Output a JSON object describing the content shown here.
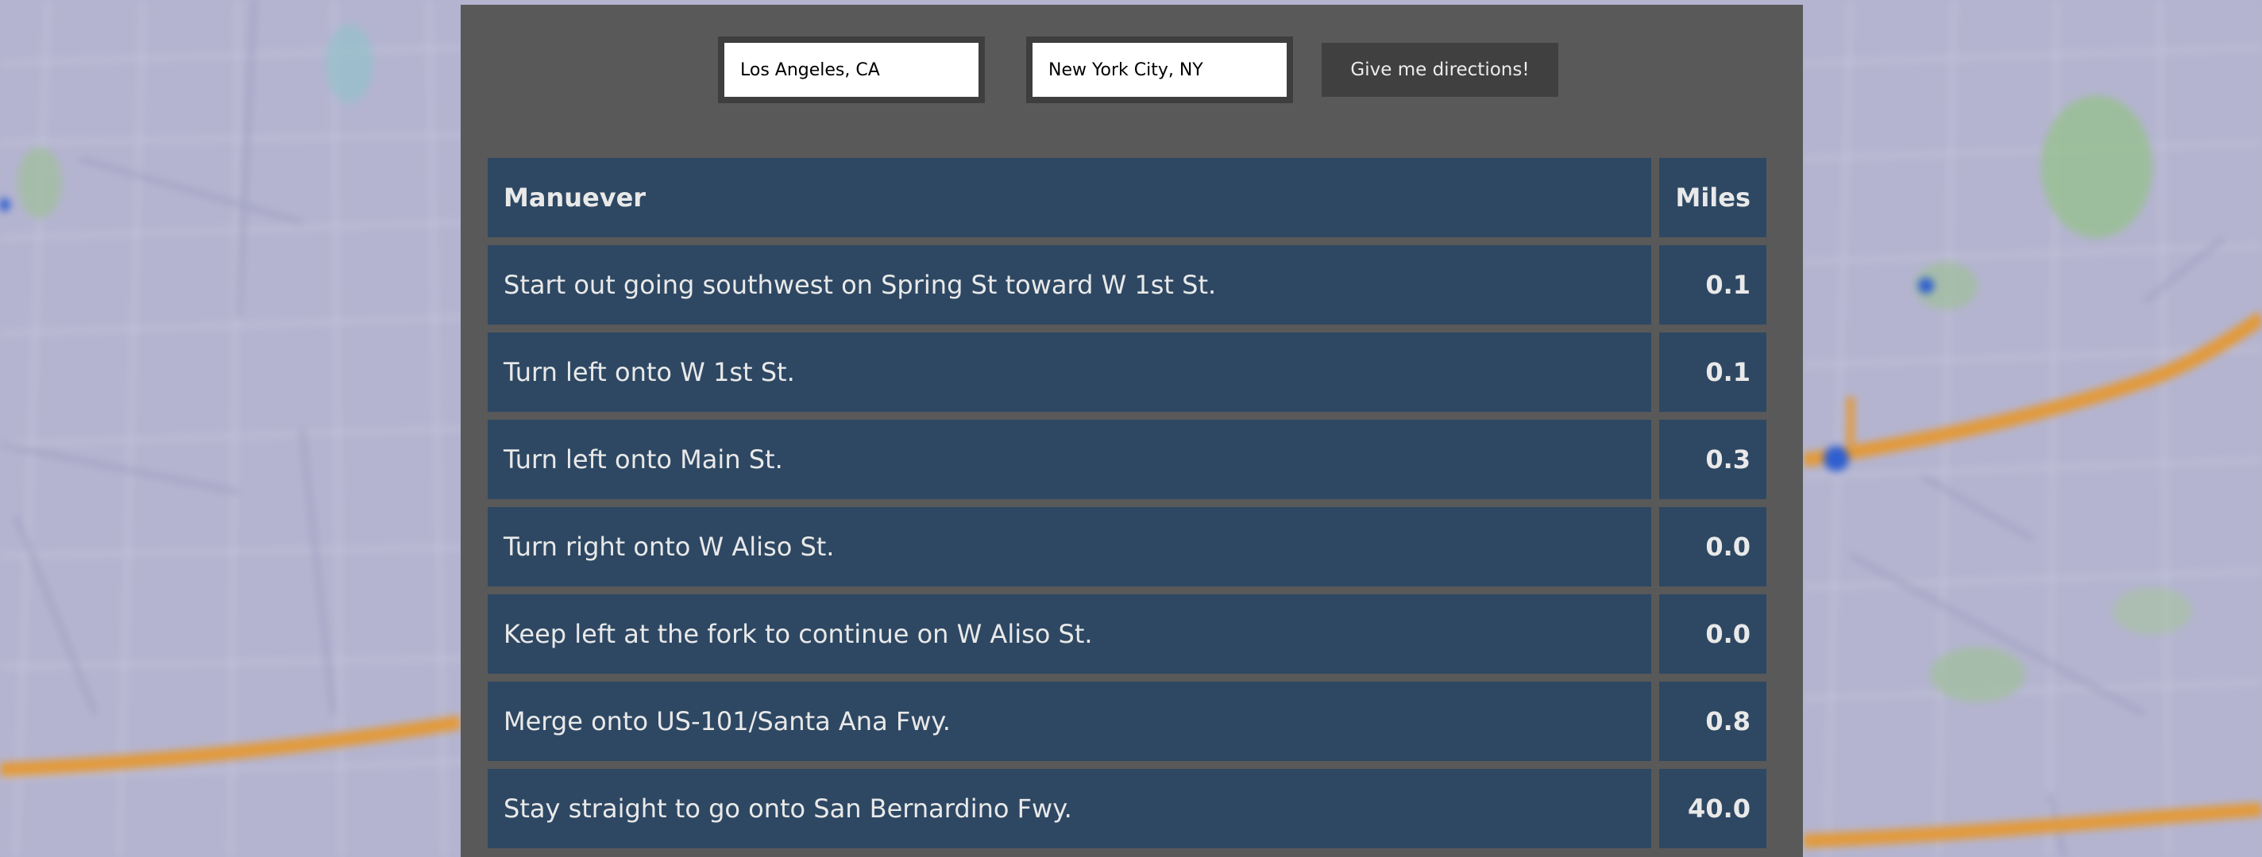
{
  "search": {
    "origin_value": "Los Angeles, CA",
    "destination_value": "New York City, NY",
    "submit_label": "Give me directions!"
  },
  "table": {
    "headers": {
      "maneuver": "Manuever",
      "miles": "Miles"
    },
    "rows": [
      {
        "maneuver": "Start out going southwest on Spring St toward W 1st St.",
        "miles": "0.1"
      },
      {
        "maneuver": "Turn left onto W 1st St.",
        "miles": "0.1"
      },
      {
        "maneuver": "Turn left onto Main St.",
        "miles": "0.3"
      },
      {
        "maneuver": "Turn right onto W Aliso St.",
        "miles": "0.0"
      },
      {
        "maneuver": "Keep left at the fork to continue on W Aliso St.",
        "miles": "0.0"
      },
      {
        "maneuver": "Merge onto US-101/Santa Ana Fwy.",
        "miles": "0.8"
      },
      {
        "maneuver": "Stay straight to go onto San Bernardino Fwy.",
        "miles": "40.0"
      }
    ]
  },
  "colors": {
    "panel_bg": "#595959",
    "cell_bg": "#2e4863",
    "button_bg": "#404040",
    "map_tint": "#b3b3cf",
    "highway": "#e39a3a"
  }
}
